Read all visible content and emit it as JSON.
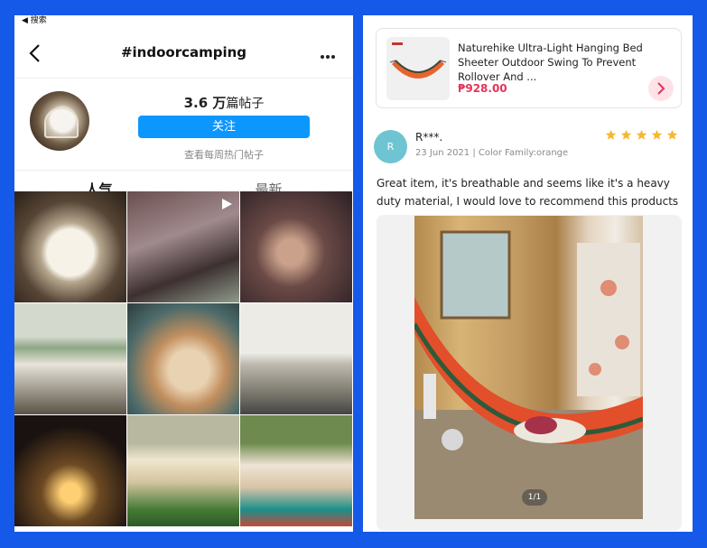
{
  "left_app": {
    "status_back": "◀ 搜索",
    "title": "#indoorcamping",
    "post_count_number": "3.6 万",
    "post_count_suffix": "篇帖子",
    "follow_label": "关注",
    "weekly_hot_link": "查看每周热门帖子",
    "tabs": [
      "人气",
      "最新"
    ],
    "grid_tiles": 9
  },
  "right_app": {
    "product": {
      "name": "Naturehike Ultra-Light Hanging Bed Sheeter Outdoor Swing To Prevent Rollover And ...",
      "price": "₱928.00"
    },
    "review": {
      "avatar_initial": "R",
      "reviewer": "R***.",
      "meta": "23 Jun 2021 | Color Family:orange",
      "rating": 5,
      "text": "Great item, it's breathable and seems like it's a heavy duty material, I would love to recommend this products",
      "photo_counter": "1/1"
    }
  },
  "colors": {
    "background": "#1559e8",
    "follow_button": "#0c97ff",
    "price": "#e5335a",
    "star": "#f5b82e",
    "reviewer_avatar": "#6ec4d3"
  }
}
